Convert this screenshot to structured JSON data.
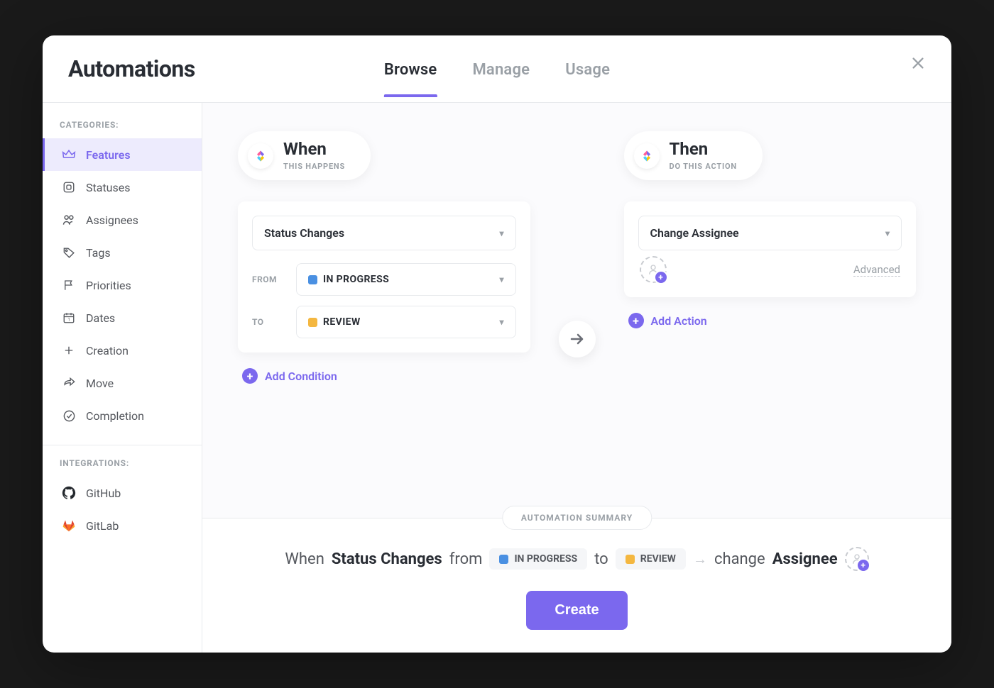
{
  "header": {
    "title": "Automations",
    "tabs": [
      "Browse",
      "Manage",
      "Usage"
    ],
    "active_tab": 0
  },
  "sidebar": {
    "categories_label": "CATEGORIES:",
    "integrations_label": "INTEGRATIONS:",
    "categories": [
      {
        "icon": "crown",
        "label": "Features",
        "active": true
      },
      {
        "icon": "square",
        "label": "Statuses"
      },
      {
        "icon": "people",
        "label": "Assignees"
      },
      {
        "icon": "tag",
        "label": "Tags"
      },
      {
        "icon": "flag",
        "label": "Priorities"
      },
      {
        "icon": "calendar",
        "label": "Dates"
      },
      {
        "icon": "plus",
        "label": "Creation"
      },
      {
        "icon": "arrow-share",
        "label": "Move"
      },
      {
        "icon": "check-circle",
        "label": "Completion"
      }
    ],
    "integrations": [
      {
        "icon": "github",
        "label": "GitHub"
      },
      {
        "icon": "gitlab",
        "label": "GitLab"
      }
    ]
  },
  "when": {
    "title": "When",
    "subtitle": "THIS HAPPENS",
    "trigger": "Status Changes",
    "from_label": "FROM",
    "to_label": "TO",
    "from_status": {
      "label": "IN PROGRESS",
      "color": "#4A90E2"
    },
    "to_status": {
      "label": "REVIEW",
      "color": "#F4B740"
    },
    "add_condition": "Add Condition"
  },
  "then": {
    "title": "Then",
    "subtitle": "DO THIS ACTION",
    "action": "Change Assignee",
    "advanced": "Advanced",
    "add_action": "Add Action"
  },
  "summary": {
    "badge": "AUTOMATION SUMMARY",
    "when_word": "When",
    "from_word": "from",
    "to_word": "to",
    "change_word": "change",
    "assignee_word": "Assignee",
    "create_button": "Create"
  }
}
